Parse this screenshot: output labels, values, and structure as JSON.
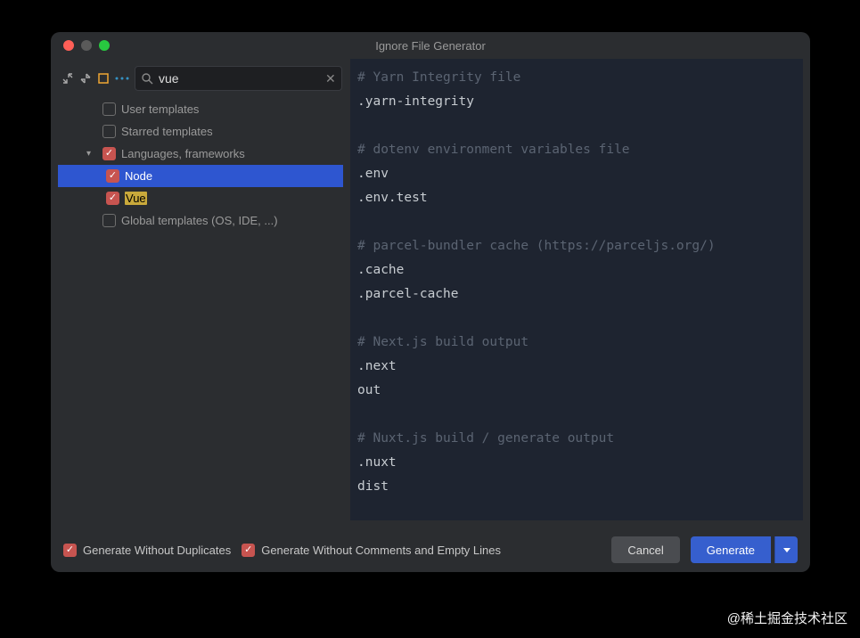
{
  "window": {
    "title": "Ignore File Generator"
  },
  "search": {
    "value": "vue"
  },
  "tree": {
    "items": [
      {
        "label": "User templates",
        "checked": false,
        "depth": 1,
        "expandable": false
      },
      {
        "label": "Starred templates",
        "checked": false,
        "depth": 1,
        "expandable": false
      },
      {
        "label": "Languages, frameworks",
        "checked": true,
        "depth": 1,
        "expandable": true,
        "expanded": true
      },
      {
        "label": "Node",
        "checked": true,
        "depth": 2,
        "selected": true
      },
      {
        "label": "Vue",
        "checked": true,
        "depth": 2,
        "highlight": "Vue"
      },
      {
        "label": "Global templates (OS, IDE, ...)",
        "checked": false,
        "depth": 1,
        "expandable": false
      }
    ]
  },
  "preview": {
    "lines": [
      {
        "text": "# Yarn Integrity file",
        "comment": true
      },
      {
        "text": ".yarn-integrity"
      },
      {
        "text": ""
      },
      {
        "text": "# dotenv environment variables file",
        "comment": true
      },
      {
        "text": ".env"
      },
      {
        "text": ".env.test"
      },
      {
        "text": ""
      },
      {
        "text": "# parcel-bundler cache (https://parceljs.org/)",
        "comment": true
      },
      {
        "text": ".cache"
      },
      {
        "text": ".parcel-cache"
      },
      {
        "text": ""
      },
      {
        "text": "# Next.js build output",
        "comment": true
      },
      {
        "text": ".next"
      },
      {
        "text": "out"
      },
      {
        "text": ""
      },
      {
        "text": "# Nuxt.js build / generate output",
        "comment": true
      },
      {
        "text": ".nuxt"
      },
      {
        "text": "dist"
      }
    ]
  },
  "footer": {
    "duplicates": {
      "label": "Generate Without Duplicates",
      "checked": true
    },
    "comments": {
      "label": "Generate Without Comments and Empty Lines",
      "checked": true
    },
    "cancel": "Cancel",
    "generate": "Generate"
  },
  "watermark": "@稀土掘金技术社区"
}
